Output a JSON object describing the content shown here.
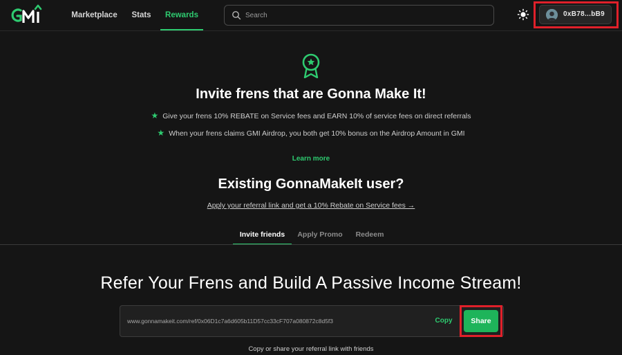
{
  "header": {
    "logo_text": "GMI",
    "nav": [
      {
        "label": "Marketplace",
        "active": false
      },
      {
        "label": "Stats",
        "active": false
      },
      {
        "label": "Rewards",
        "active": true
      }
    ],
    "search_placeholder": "Search",
    "wallet_address": "0xB78...bB9",
    "icons": {
      "search": "search-icon",
      "theme": "sun-icon",
      "avatar": "avatar"
    }
  },
  "invite": {
    "icon": "award-badge-icon",
    "title": "Invite frens that are Gonna Make It!",
    "benefits": [
      "Give your frens 10% REBATE on Service fees and EARN 10% of service fees on direct referrals",
      "When your frens claims GMI Airdrop, you both get 10% bonus on the Airdrop Amount in GMI"
    ],
    "learn_more": "Learn more"
  },
  "existing": {
    "title": "Existing GonnaMakeIt user?",
    "link": "Apply your referral link and get a 10% Rebate on Service fees →"
  },
  "tabs": [
    {
      "label": "Invite friends",
      "active": true
    },
    {
      "label": "Apply Promo",
      "active": false
    },
    {
      "label": "Redeem",
      "active": false
    }
  ],
  "refer": {
    "title": "Refer Your Frens and Build A Passive Income Stream!",
    "referral_link": "www.gonnamakeit.com/ref/0x06D1c7a6d605b11D57cc33cF707a080872c8d5f3",
    "copy_label": "Copy",
    "share_label": "Share",
    "caption": "Copy or share your referral link with friends"
  },
  "colors": {
    "accent": "#2ecb70",
    "background": "#151515",
    "highlight": "#e0202a"
  }
}
